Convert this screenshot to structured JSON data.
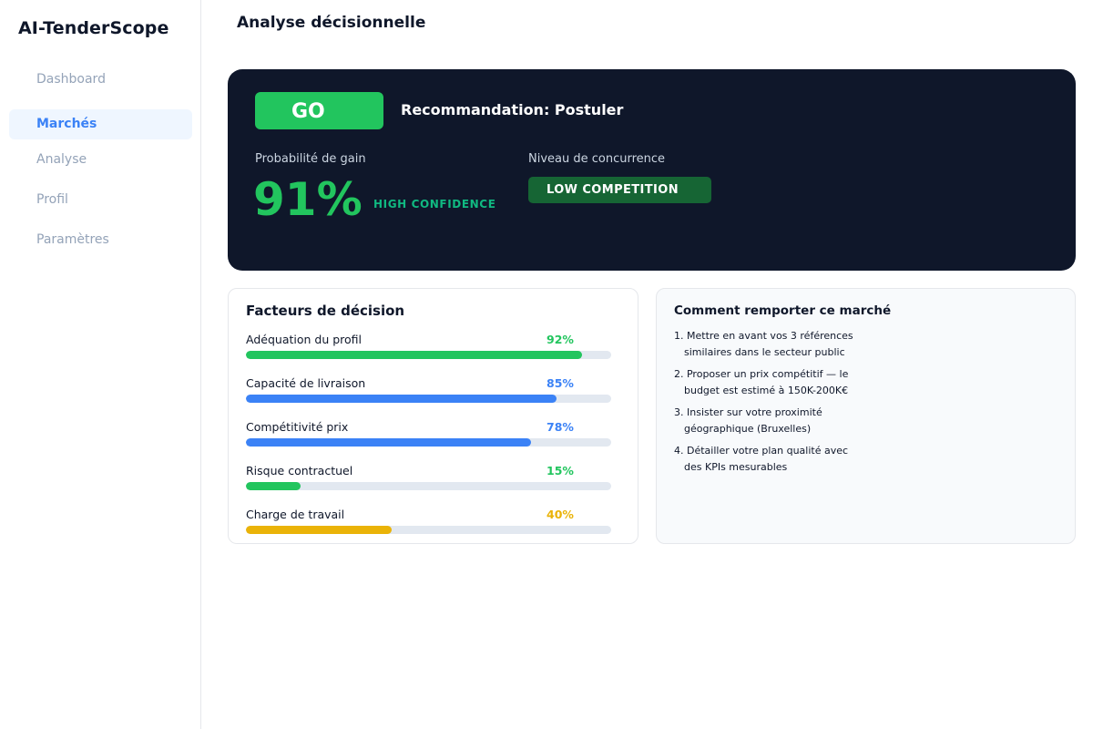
{
  "app": {
    "brand": "AI-TenderScope"
  },
  "sidebar": {
    "items": [
      {
        "label": "Dashboard",
        "active": false
      },
      {
        "label": "Marchés",
        "active": true
      },
      {
        "label": "Analyse",
        "active": false
      },
      {
        "label": "Profil",
        "active": false
      },
      {
        "label": "Paramètres",
        "active": false
      }
    ]
  },
  "main": {
    "title": "Analyse décisionnelle",
    "hero": {
      "decision": "GO",
      "recommendation": "Recommandation: Postuler",
      "probability_label": "Probabilité de gain",
      "probability_value": "91%",
      "confidence": "HIGH CONFIDENCE",
      "competition_label": "Niveau de concurrence",
      "competition_value": "LOW COMPETITION"
    },
    "factors": {
      "title": "Facteurs de décision",
      "items": [
        {
          "label": "Adéquation du profil",
          "pct": "92%",
          "value": 92,
          "color": "#22c55e"
        },
        {
          "label": "Capacité de livraison",
          "pct": "85%",
          "value": 85,
          "color": "#3b82f6"
        },
        {
          "label": "Compétitivité prix",
          "pct": "78%",
          "value": 78,
          "color": "#3b82f6"
        },
        {
          "label": "Risque contractuel",
          "pct": "15%",
          "value": 15,
          "color": "#22c55e"
        },
        {
          "label": "Charge de travail",
          "pct": "40%",
          "value": 40,
          "color": "#eab308"
        }
      ]
    },
    "tips": {
      "title": "Comment remporter ce marché",
      "items": [
        {
          "line1": "1. Mettre en avant vos 3 références",
          "line2": "similaires dans le secteur public"
        },
        {
          "line1": "2. Proposer un prix compétitif — le",
          "line2": "budget est estimé à 150K-200K€"
        },
        {
          "line1": "3. Insister sur votre proximité",
          "line2": "géographique (Bruxelles)"
        },
        {
          "line1": "4. Détailler votre plan qualité avec",
          "line2": "des KPIs mesurables"
        }
      ]
    }
  },
  "colors": {
    "accent": "#3b82f6",
    "success": "#22c55e",
    "warning": "#eab308",
    "hero_bg": "#0f172a"
  }
}
